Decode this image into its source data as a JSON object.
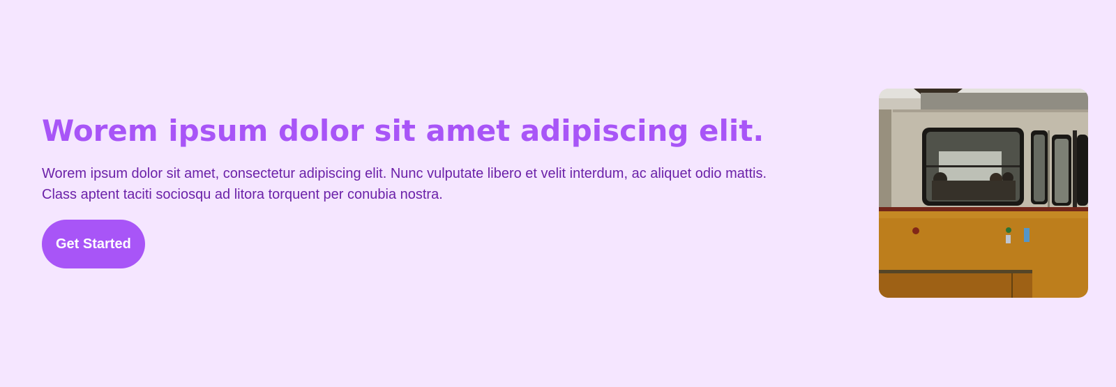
{
  "hero": {
    "title": "Worem ipsum dolor sit amet adipiscing elit.",
    "description": "Worem ipsum dolor sit amet, consectetur adipiscing elit. Nunc vulputate libero et velit interdum, ac aliquet odio mattis. Class aptent taciti sociosqu ad litora torquent per conubia nostra.",
    "cta_label": "Get Started",
    "image_subject": "tram-photo"
  },
  "colors": {
    "background": "#f5e6ff",
    "accent": "#a855f7",
    "body_text": "#6b21a8",
    "button_text": "#ffffff"
  }
}
